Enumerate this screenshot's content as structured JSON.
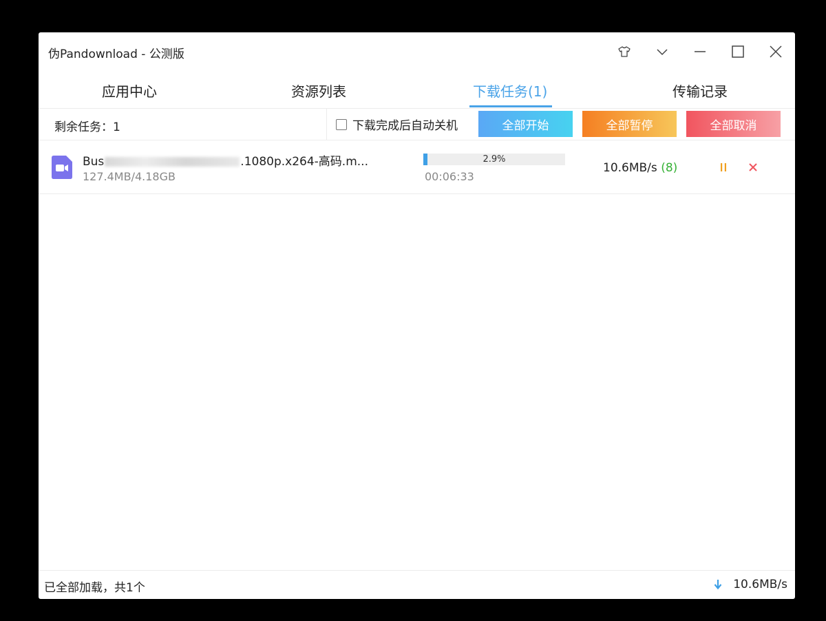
{
  "app": {
    "title": "伪Pandownload - 公测版"
  },
  "window_controls": {
    "skin_icon": "shirt-icon",
    "menu_icon": "chevron-down-icon",
    "minimize_icon": "minimize-icon",
    "maximize_icon": "maximize-icon",
    "close_icon": "close-icon"
  },
  "tabs": [
    {
      "label": "应用中心",
      "active": false
    },
    {
      "label": "资源列表",
      "active": false
    },
    {
      "label": "下载任务(1)",
      "active": true
    },
    {
      "label": "传输记录",
      "active": false
    }
  ],
  "toolbar": {
    "remaining_label": "剩余任务：1",
    "auto_shutdown_label": "下载完成后自动关机",
    "auto_shutdown_checked": false,
    "start_all_label": "全部开始",
    "pause_all_label": "全部暂停",
    "cancel_all_label": "全部取消"
  },
  "tasks": [
    {
      "icon": "video-file-icon",
      "name_prefix": "Bus",
      "name_suffix": ".1080p.x264-高码.m...",
      "size": "127.4MB/4.18GB",
      "progress": 0.029,
      "progress_label": "2.9%",
      "eta": "00:06:33",
      "speed": "10.6MB/s",
      "connections": "(8)"
    }
  ],
  "colors": {
    "accent": "#4aa3e8",
    "pause_icon": "#f0a020",
    "cancel_icon": "#f0555f",
    "connections": "#35b135"
  },
  "statusbar": {
    "loaded_text": "已全部加载，共1个",
    "total_speed": "10.6MB/s"
  }
}
